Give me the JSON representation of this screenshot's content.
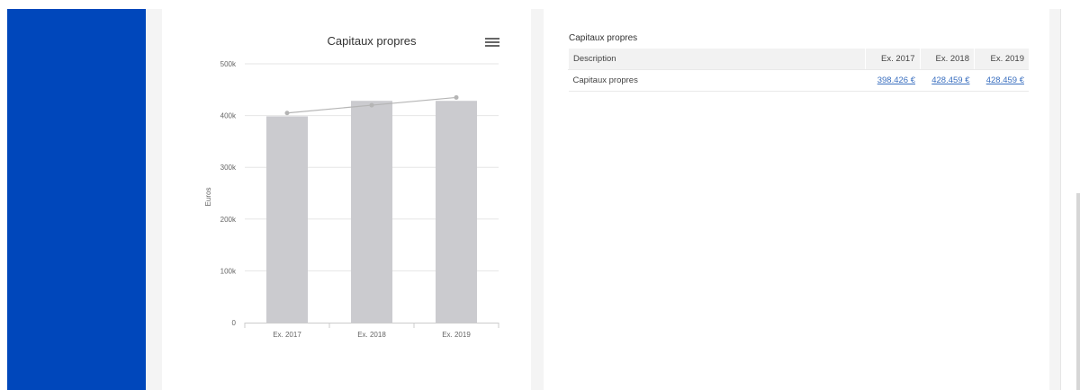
{
  "chart_data": {
    "type": "bar",
    "title": "Capitaux propres",
    "ylabel": "Euros",
    "xlabel": "",
    "categories": [
      "Ex. 2017",
      "Ex. 2018",
      "Ex. 2019"
    ],
    "ylim": [
      0,
      500000
    ],
    "yticks": [
      {
        "value": 0,
        "label": "0"
      },
      {
        "value": 100000,
        "label": "100k"
      },
      {
        "value": 200000,
        "label": "200k"
      },
      {
        "value": 300000,
        "label": "300k"
      },
      {
        "value": 400000,
        "label": "400k"
      },
      {
        "value": 500000,
        "label": "500k"
      }
    ],
    "series": [
      {
        "type": "bar",
        "values": [
          398426,
          428459,
          428459
        ],
        "color": "#cbcbcf"
      },
      {
        "type": "line",
        "values": [
          405000,
          420000,
          435000
        ],
        "color": "#b5b5b5"
      }
    ],
    "grid": true,
    "legend": "none"
  },
  "table": {
    "title": "Capitaux propres",
    "headers": [
      "Description",
      "Ex. 2017",
      "Ex. 2018",
      "Ex. 2019"
    ],
    "rows": [
      {
        "label": "Capitaux propres",
        "values": [
          "398.426 €",
          "428.459 €",
          "428.459 €"
        ]
      }
    ]
  },
  "colors": {
    "sidebar": "#0047bb",
    "link": "#3a6fbf"
  }
}
